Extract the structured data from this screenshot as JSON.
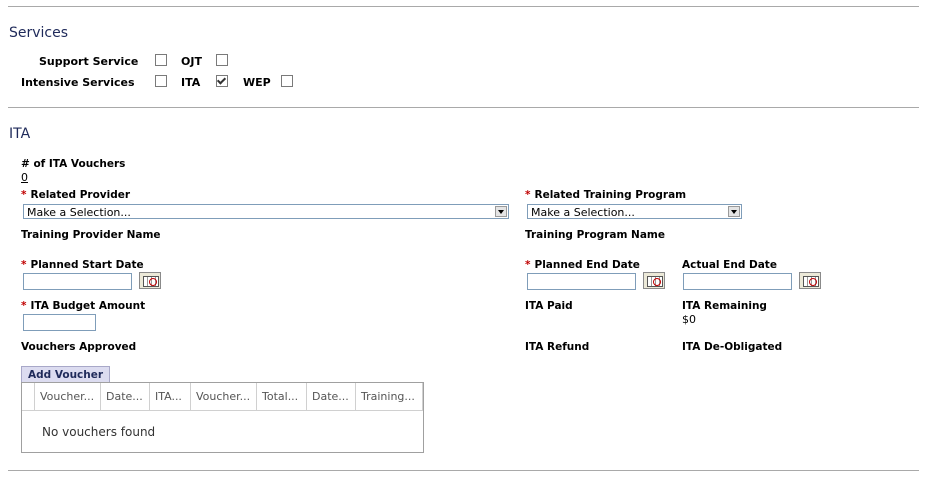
{
  "services": {
    "title": "Services",
    "support_service_label": "Support Service",
    "ojt_label": "OJT",
    "intensive_services_label": "Intensive Services",
    "ita_label": "ITA",
    "wep_label": "WEP",
    "support_service_checked": false,
    "ojt_checked": false,
    "intensive_services_checked": false,
    "ita_checked": true,
    "wep_checked": false
  },
  "ita": {
    "title": "ITA",
    "vouchers_count_label": "# of ITA Vouchers",
    "vouchers_count_value": "0",
    "required_marker": "*",
    "related_provider_label": "Related Provider",
    "related_provider_value": "Make a Selection...",
    "related_training_program_label": "Related Training Program",
    "related_training_program_value": "Make a Selection...",
    "training_provider_name_label": "Training Provider Name",
    "training_program_name_label": "Training Program Name",
    "planned_start_date_label": "Planned Start Date",
    "planned_end_date_label": "Planned End Date",
    "actual_end_date_label": "Actual End Date",
    "ita_budget_amount_label": "ITA Budget Amount",
    "ita_paid_label": "ITA Paid",
    "ita_remaining_label": "ITA Remaining",
    "ita_remaining_value": "$0",
    "vouchers_approved_label": "Vouchers Approved",
    "ita_refund_label": "ITA Refund",
    "ita_deobligated_label": "ITA De-Obligated"
  },
  "vouchers": {
    "add_button_label": "Add Voucher",
    "columns": [
      "Voucher...",
      "Date...",
      "ITA...",
      "Voucher...",
      "Total...",
      "Date...",
      "Training..."
    ],
    "empty_message": "No vouchers found"
  },
  "colors": {
    "required": "#c00000",
    "section_title": "#1f2a5a",
    "rule": "#a9a9a9"
  },
  "icons": {
    "calendar": "calendar-icon",
    "dropdown": "chevron-down-icon"
  }
}
